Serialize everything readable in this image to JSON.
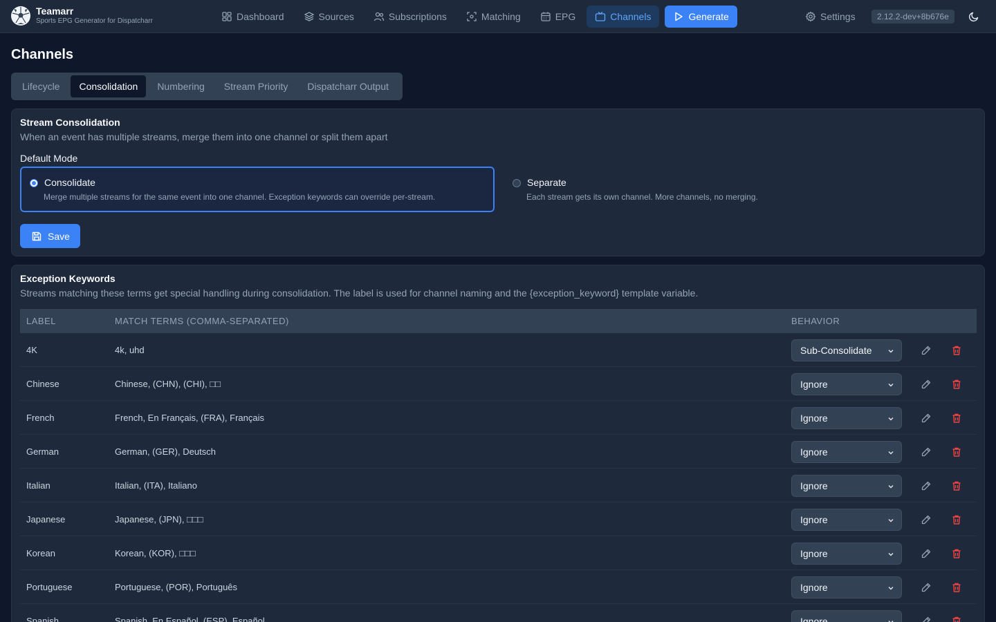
{
  "app": {
    "title": "Teamarr",
    "subtitle": "Sports EPG Generator for Dispatcharr",
    "version": "2.12.2-dev+8b676e"
  },
  "nav": {
    "items": [
      {
        "label": "Dashboard",
        "icon": "dashboard-icon"
      },
      {
        "label": "Sources",
        "icon": "layers-icon"
      },
      {
        "label": "Subscriptions",
        "icon": "users-icon"
      },
      {
        "label": "Matching",
        "icon": "scan-icon"
      },
      {
        "label": "EPG",
        "icon": "calendar-icon"
      },
      {
        "label": "Channels",
        "icon": "tv-icon",
        "active": true
      }
    ],
    "generate_label": "Generate",
    "settings_label": "Settings"
  },
  "page": {
    "title": "Channels"
  },
  "tabs": [
    {
      "label": "Lifecycle"
    },
    {
      "label": "Consolidation",
      "active": true
    },
    {
      "label": "Numbering"
    },
    {
      "label": "Stream Priority"
    },
    {
      "label": "Dispatcharr Output"
    }
  ],
  "consolidation": {
    "title": "Stream Consolidation",
    "description": "When an event has multiple streams, merge them into one channel or split them apart",
    "mode_label": "Default Mode",
    "options": [
      {
        "name": "Consolidate",
        "description": "Merge multiple streams for the same event into one channel. Exception keywords can override per-stream.",
        "selected": true
      },
      {
        "name": "Separate",
        "description": "Each stream gets its own channel. More channels, no merging.",
        "selected": false
      }
    ],
    "save_label": "Save"
  },
  "exceptions": {
    "title": "Exception Keywords",
    "description": "Streams matching these terms get special handling during consolidation. The label is used for channel naming and the {exception_keyword} template variable.",
    "columns": {
      "label": "LABEL",
      "match": "MATCH TERMS (COMMA-SEPARATED)",
      "behavior": "BEHAVIOR"
    },
    "rows": [
      {
        "label": "4K",
        "match": "4k, uhd",
        "behavior": "Sub-Consolidate"
      },
      {
        "label": "Chinese",
        "match": "Chinese, (CHN), (CHI), □□",
        "behavior": "Ignore"
      },
      {
        "label": "French",
        "match": "French, En Français, (FRA), Français",
        "behavior": "Ignore"
      },
      {
        "label": "German",
        "match": "German, (GER), Deutsch",
        "behavior": "Ignore"
      },
      {
        "label": "Italian",
        "match": "Italian, (ITA), Italiano",
        "behavior": "Ignore"
      },
      {
        "label": "Japanese",
        "match": "Japanese, (JPN), □□□",
        "behavior": "Ignore"
      },
      {
        "label": "Korean",
        "match": "Korean, (KOR), □□□",
        "behavior": "Ignore"
      },
      {
        "label": "Portuguese",
        "match": "Portuguese, (POR), Português",
        "behavior": "Ignore"
      },
      {
        "label": "Spanish",
        "match": "Spanish, En Español, (ESP), Español",
        "behavior": "Ignore"
      }
    ]
  },
  "colors": {
    "accent": "#3b82f6",
    "delete": "#ef4444",
    "background": "#0f172a",
    "card": "#1e293b"
  }
}
